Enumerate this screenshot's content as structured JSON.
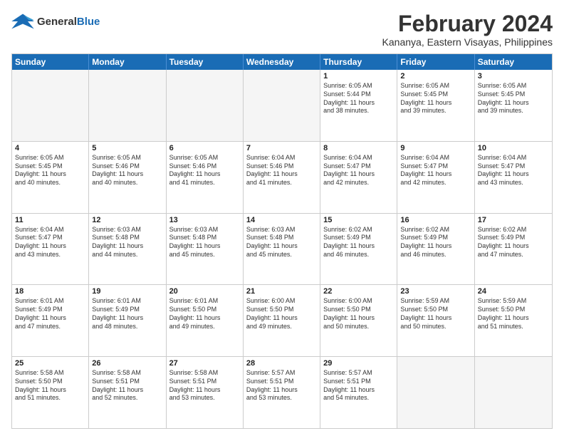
{
  "logo": {
    "line1": "General",
    "line2": "Blue"
  },
  "title": "February 2024",
  "location": "Kananya, Eastern Visayas, Philippines",
  "days": [
    "Sunday",
    "Monday",
    "Tuesday",
    "Wednesday",
    "Thursday",
    "Friday",
    "Saturday"
  ],
  "weeks": [
    [
      {
        "day": "",
        "empty": true
      },
      {
        "day": "",
        "empty": true
      },
      {
        "day": "",
        "empty": true
      },
      {
        "day": "",
        "empty": true
      },
      {
        "day": "1",
        "text": "Sunrise: 6:05 AM\nSunset: 5:44 PM\nDaylight: 11 hours\nand 38 minutes."
      },
      {
        "day": "2",
        "text": "Sunrise: 6:05 AM\nSunset: 5:45 PM\nDaylight: 11 hours\nand 39 minutes."
      },
      {
        "day": "3",
        "text": "Sunrise: 6:05 AM\nSunset: 5:45 PM\nDaylight: 11 hours\nand 39 minutes."
      }
    ],
    [
      {
        "day": "4",
        "text": "Sunrise: 6:05 AM\nSunset: 5:45 PM\nDaylight: 11 hours\nand 40 minutes."
      },
      {
        "day": "5",
        "text": "Sunrise: 6:05 AM\nSunset: 5:46 PM\nDaylight: 11 hours\nand 40 minutes."
      },
      {
        "day": "6",
        "text": "Sunrise: 6:05 AM\nSunset: 5:46 PM\nDaylight: 11 hours\nand 41 minutes."
      },
      {
        "day": "7",
        "text": "Sunrise: 6:04 AM\nSunset: 5:46 PM\nDaylight: 11 hours\nand 41 minutes."
      },
      {
        "day": "8",
        "text": "Sunrise: 6:04 AM\nSunset: 5:47 PM\nDaylight: 11 hours\nand 42 minutes."
      },
      {
        "day": "9",
        "text": "Sunrise: 6:04 AM\nSunset: 5:47 PM\nDaylight: 11 hours\nand 42 minutes."
      },
      {
        "day": "10",
        "text": "Sunrise: 6:04 AM\nSunset: 5:47 PM\nDaylight: 11 hours\nand 43 minutes."
      }
    ],
    [
      {
        "day": "11",
        "text": "Sunrise: 6:04 AM\nSunset: 5:47 PM\nDaylight: 11 hours\nand 43 minutes."
      },
      {
        "day": "12",
        "text": "Sunrise: 6:03 AM\nSunset: 5:48 PM\nDaylight: 11 hours\nand 44 minutes."
      },
      {
        "day": "13",
        "text": "Sunrise: 6:03 AM\nSunset: 5:48 PM\nDaylight: 11 hours\nand 45 minutes."
      },
      {
        "day": "14",
        "text": "Sunrise: 6:03 AM\nSunset: 5:48 PM\nDaylight: 11 hours\nand 45 minutes."
      },
      {
        "day": "15",
        "text": "Sunrise: 6:02 AM\nSunset: 5:49 PM\nDaylight: 11 hours\nand 46 minutes."
      },
      {
        "day": "16",
        "text": "Sunrise: 6:02 AM\nSunset: 5:49 PM\nDaylight: 11 hours\nand 46 minutes."
      },
      {
        "day": "17",
        "text": "Sunrise: 6:02 AM\nSunset: 5:49 PM\nDaylight: 11 hours\nand 47 minutes."
      }
    ],
    [
      {
        "day": "18",
        "text": "Sunrise: 6:01 AM\nSunset: 5:49 PM\nDaylight: 11 hours\nand 47 minutes."
      },
      {
        "day": "19",
        "text": "Sunrise: 6:01 AM\nSunset: 5:49 PM\nDaylight: 11 hours\nand 48 minutes."
      },
      {
        "day": "20",
        "text": "Sunrise: 6:01 AM\nSunset: 5:50 PM\nDaylight: 11 hours\nand 49 minutes."
      },
      {
        "day": "21",
        "text": "Sunrise: 6:00 AM\nSunset: 5:50 PM\nDaylight: 11 hours\nand 49 minutes."
      },
      {
        "day": "22",
        "text": "Sunrise: 6:00 AM\nSunset: 5:50 PM\nDaylight: 11 hours\nand 50 minutes."
      },
      {
        "day": "23",
        "text": "Sunrise: 5:59 AM\nSunset: 5:50 PM\nDaylight: 11 hours\nand 50 minutes."
      },
      {
        "day": "24",
        "text": "Sunrise: 5:59 AM\nSunset: 5:50 PM\nDaylight: 11 hours\nand 51 minutes."
      }
    ],
    [
      {
        "day": "25",
        "text": "Sunrise: 5:58 AM\nSunset: 5:50 PM\nDaylight: 11 hours\nand 51 minutes."
      },
      {
        "day": "26",
        "text": "Sunrise: 5:58 AM\nSunset: 5:51 PM\nDaylight: 11 hours\nand 52 minutes."
      },
      {
        "day": "27",
        "text": "Sunrise: 5:58 AM\nSunset: 5:51 PM\nDaylight: 11 hours\nand 53 minutes."
      },
      {
        "day": "28",
        "text": "Sunrise: 5:57 AM\nSunset: 5:51 PM\nDaylight: 11 hours\nand 53 minutes."
      },
      {
        "day": "29",
        "text": "Sunrise: 5:57 AM\nSunset: 5:51 PM\nDaylight: 11 hours\nand 54 minutes."
      },
      {
        "day": "",
        "empty": true
      },
      {
        "day": "",
        "empty": true
      }
    ]
  ]
}
